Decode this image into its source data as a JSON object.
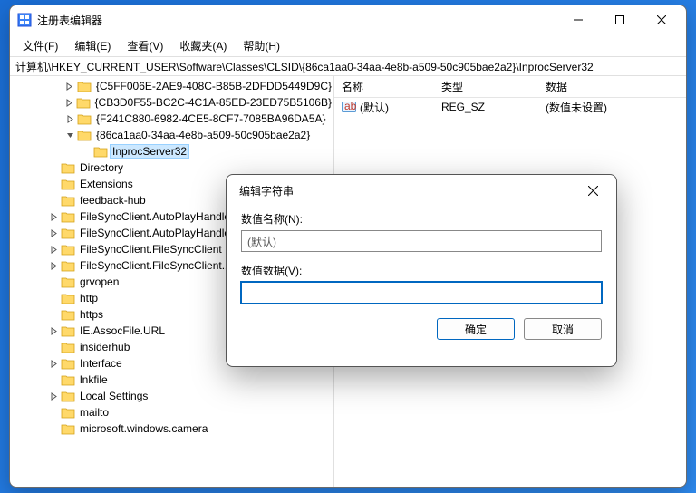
{
  "window": {
    "title": "注册表编辑器",
    "min": "—",
    "max": "▢",
    "close": "✕"
  },
  "menu": {
    "file": "文件(F)",
    "edit": "编辑(E)",
    "view": "查看(V)",
    "fav": "收藏夹(A)",
    "help": "帮助(H)"
  },
  "address": "计算机\\HKEY_CURRENT_USER\\Software\\Classes\\CLSID\\{86ca1aa0-34aa-4e8b-a509-50c905bae2a2}\\InprocServer32",
  "tree": [
    {
      "indent": 2,
      "toggle": ">",
      "label": "{C5FF006E-2AE9-408C-B85B-2DFDD5449D9C}"
    },
    {
      "indent": 2,
      "toggle": ">",
      "label": "{CB3D0F55-BC2C-4C1A-85ED-23ED75B5106B}"
    },
    {
      "indent": 2,
      "toggle": ">",
      "label": "{F241C880-6982-4CE5-8CF7-7085BA96DA5A}"
    },
    {
      "indent": 2,
      "toggle": "v",
      "label": "{86ca1aa0-34aa-4e8b-a509-50c905bae2a2}"
    },
    {
      "indent": 3,
      "toggle": "",
      "label": "InprocServer32",
      "selected": true
    },
    {
      "indent": 1,
      "toggle": "",
      "label": "Directory"
    },
    {
      "indent": 1,
      "toggle": "",
      "label": "Extensions"
    },
    {
      "indent": 1,
      "toggle": "",
      "label": "feedback-hub"
    },
    {
      "indent": 1,
      "toggle": ">",
      "label": "FileSyncClient.AutoPlayHandler"
    },
    {
      "indent": 1,
      "toggle": ">",
      "label": "FileSyncClient.AutoPlayHandler"
    },
    {
      "indent": 1,
      "toggle": ">",
      "label": "FileSyncClient.FileSyncClient"
    },
    {
      "indent": 1,
      "toggle": ">",
      "label": "FileSyncClient.FileSyncClient.1"
    },
    {
      "indent": 1,
      "toggle": "",
      "label": "grvopen"
    },
    {
      "indent": 1,
      "toggle": "",
      "label": "http"
    },
    {
      "indent": 1,
      "toggle": "",
      "label": "https"
    },
    {
      "indent": 1,
      "toggle": ">",
      "label": "IE.AssocFile.URL"
    },
    {
      "indent": 1,
      "toggle": "",
      "label": "insiderhub"
    },
    {
      "indent": 1,
      "toggle": ">",
      "label": "Interface"
    },
    {
      "indent": 1,
      "toggle": "",
      "label": "lnkfile"
    },
    {
      "indent": 1,
      "toggle": ">",
      "label": "Local Settings"
    },
    {
      "indent": 1,
      "toggle": "",
      "label": "mailto"
    },
    {
      "indent": 1,
      "toggle": "",
      "label": "microsoft.windows.camera"
    }
  ],
  "list": {
    "headers": {
      "name": "名称",
      "type": "类型",
      "data": "数据"
    },
    "rows": [
      {
        "name": "(默认)",
        "type": "REG_SZ",
        "data": "(数值未设置)"
      }
    ]
  },
  "dialog": {
    "title": "编辑字符串",
    "name_label": "数值名称(N):",
    "name_value": "(默认)",
    "data_label": "数值数据(V):",
    "data_value": "",
    "ok": "确定",
    "cancel": "取消",
    "close": "✕"
  }
}
